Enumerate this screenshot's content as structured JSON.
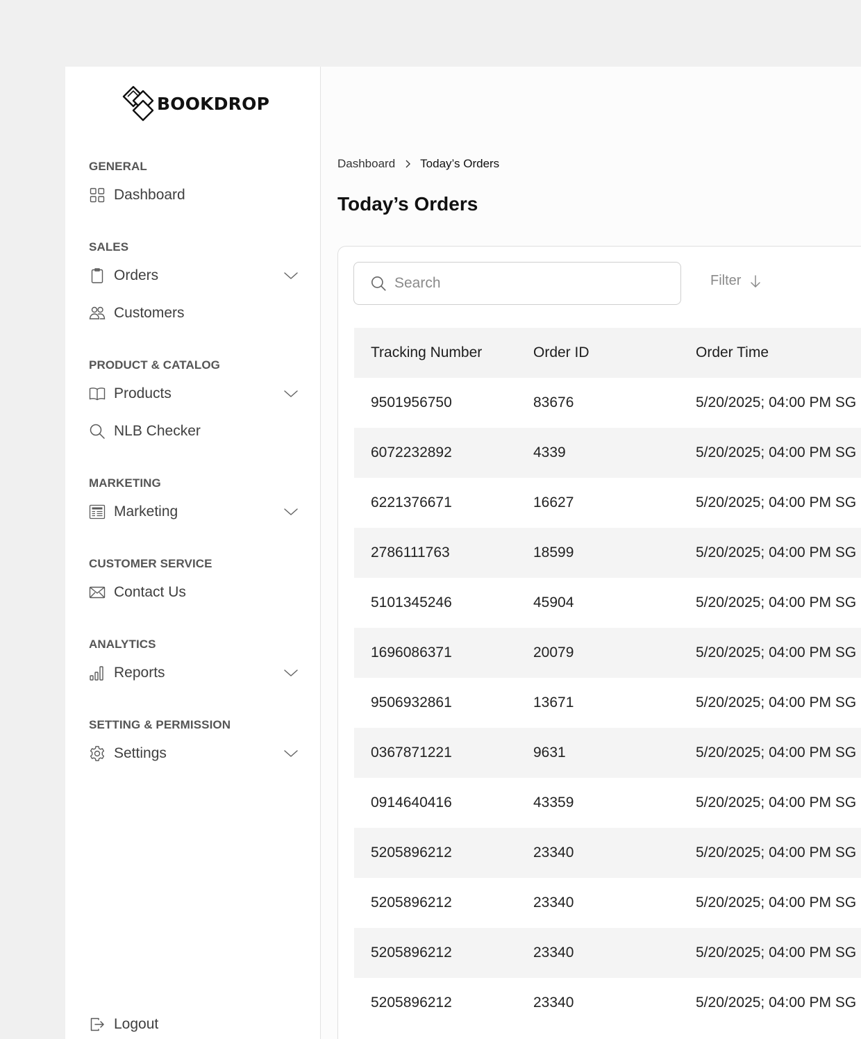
{
  "brand": {
    "name": "BOOKDROP"
  },
  "sidebar": {
    "sections": [
      {
        "title": "GENERAL",
        "items": [
          {
            "label": "Dashboard",
            "icon": "grid-icon",
            "has_chevron": false
          }
        ]
      },
      {
        "title": "SALES",
        "items": [
          {
            "label": "Orders",
            "icon": "clipboard-icon",
            "has_chevron": true
          },
          {
            "label": "Customers",
            "icon": "users-icon",
            "has_chevron": false
          }
        ]
      },
      {
        "title": "PRODUCT & CATALOG",
        "items": [
          {
            "label": "Products",
            "icon": "book-icon",
            "has_chevron": true
          },
          {
            "label": "NLB Checker",
            "icon": "search-icon",
            "has_chevron": false
          }
        ]
      },
      {
        "title": "MARKETING",
        "items": [
          {
            "label": "Marketing",
            "icon": "newspaper-icon",
            "has_chevron": true
          }
        ]
      },
      {
        "title": "CUSTOMER SERVICE",
        "items": [
          {
            "label": "Contact Us",
            "icon": "mail-icon",
            "has_chevron": false
          }
        ]
      },
      {
        "title": "ANALYTICS",
        "items": [
          {
            "label": "Reports",
            "icon": "bar-chart-icon",
            "has_chevron": true
          }
        ]
      },
      {
        "title": "SETTING & PERMISSION",
        "items": [
          {
            "label": "Settings",
            "icon": "gear-icon",
            "has_chevron": true
          }
        ]
      }
    ],
    "logout_label": "Logout"
  },
  "breadcrumb": {
    "parent": "Dashboard",
    "current": "Today’s Orders"
  },
  "page_title": "Today’s Orders",
  "search": {
    "placeholder": "Search",
    "value": ""
  },
  "filter": {
    "label": "Filter"
  },
  "table": {
    "columns": [
      "Tracking Number",
      "Order ID",
      "Order Time"
    ],
    "rows": [
      [
        "9501956750",
        "83676",
        "5/20/2025; 04:00 PM SG"
      ],
      [
        "6072232892",
        "4339",
        "5/20/2025; 04:00 PM SG"
      ],
      [
        "6221376671",
        "16627",
        "5/20/2025; 04:00 PM SG"
      ],
      [
        "2786111763",
        "18599",
        "5/20/2025; 04:00 PM SG"
      ],
      [
        "5101345246",
        "45904",
        "5/20/2025; 04:00 PM SG"
      ],
      [
        "1696086371",
        "20079",
        "5/20/2025; 04:00 PM SG"
      ],
      [
        "9506932861",
        "13671",
        "5/20/2025; 04:00 PM SG"
      ],
      [
        "0367871221",
        "9631",
        "5/20/2025; 04:00 PM SG"
      ],
      [
        "0914640416",
        "43359",
        "5/20/2025; 04:00 PM SG"
      ],
      [
        "5205896212",
        "23340",
        "5/20/2025; 04:00 PM SG"
      ],
      [
        "5205896212",
        "23340",
        "5/20/2025; 04:00 PM SG"
      ],
      [
        "5205896212",
        "23340",
        "5/20/2025; 04:00 PM SG"
      ],
      [
        "5205896212",
        "23340",
        "5/20/2025; 04:00 PM SG"
      ]
    ]
  }
}
